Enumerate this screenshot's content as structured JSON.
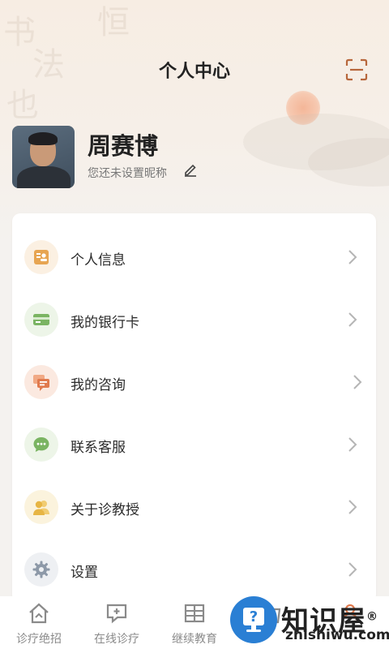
{
  "header": {
    "title": "个人中心",
    "scan_icon": "scan-icon"
  },
  "profile": {
    "name": "周赛博",
    "nickname_hint": "您还未设置昵称",
    "edit_icon": "pencil-icon"
  },
  "menu": [
    {
      "label": "个人信息",
      "icon": "id-card-icon",
      "color": "#e7a552",
      "bg": "#fbf0e2"
    },
    {
      "label": "我的银行卡",
      "icon": "bank-card-icon",
      "color": "#7ab462",
      "bg": "#edf5e8"
    },
    {
      "label": "我的咨询",
      "icon": "chat-bubbles-icon",
      "color": "#e07a4e",
      "bg": "#fbe9e0"
    },
    {
      "label": "联系客服",
      "icon": "message-icon",
      "color": "#7ab462",
      "bg": "#edf5e8"
    },
    {
      "label": "关于诊教授",
      "icon": "people-icon",
      "color": "#e7b544",
      "bg": "#fbf3dd"
    },
    {
      "label": "设置",
      "icon": "gear-icon",
      "color": "#8d99a8",
      "bg": "#eef0f3"
    }
  ],
  "tabs": [
    {
      "label": "诊疗绝招",
      "icon": "house-icon"
    },
    {
      "label": "在线诊疗",
      "icon": "consult-icon"
    },
    {
      "label": "继续教育",
      "icon": "book-icon"
    },
    {
      "label": "",
      "icon": "shop-icon"
    },
    {
      "label": "",
      "icon": "profile-icon"
    }
  ],
  "watermark": {
    "text": "知识屋",
    "reg": "®",
    "sub": "zhishiwu.com",
    "badge_icon": "question-monitor-icon",
    "color": "#2a7fd4"
  }
}
